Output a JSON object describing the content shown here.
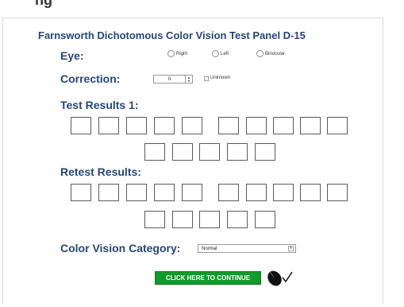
{
  "title": "Farnsworth Dichotomous Color Vision Test Panel D-15",
  "top_heading": "ng",
  "eye": {
    "label": "Eye:",
    "options": [
      "Right",
      "Left",
      "Binocular"
    ]
  },
  "correction": {
    "label": "Correction:",
    "value": "0",
    "unknown_label": "Unknown"
  },
  "test_results": {
    "label": "Test Results 1:"
  },
  "retest_results": {
    "label": "Retest Results:"
  },
  "category": {
    "label": "Color Vision Category:",
    "selected": "Normal"
  },
  "continue_button": "CLICK HERE TO CONTINUE",
  "icons": {
    "stepper": "stepper-arrows-icon",
    "select": "dropdown-arrow-icon",
    "mouse": "mouse-click-icon"
  }
}
